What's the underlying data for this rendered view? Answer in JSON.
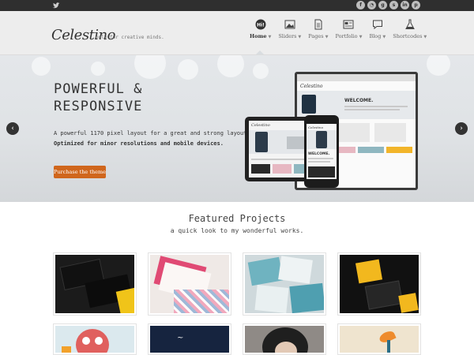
{
  "topbar": {
    "twitter_icon": "twitter-icon",
    "social_icons": [
      "facebook-icon",
      "rss-icon",
      "google-plus-icon",
      "skype-icon",
      "linkedin-icon",
      "pinterest-icon"
    ]
  },
  "header": {
    "logo": "Celestino",
    "tagline": "only for creative minds."
  },
  "nav": [
    {
      "label": "Home",
      "icon": "hi-bubble-icon",
      "active": true
    },
    {
      "label": "Sliders",
      "icon": "slider-image-icon",
      "active": false
    },
    {
      "label": "Pages",
      "icon": "page-icon",
      "active": false
    },
    {
      "label": "Portfolio",
      "icon": "portfolio-icon",
      "active": false
    },
    {
      "label": "Blog",
      "icon": "blog-bubble-icon",
      "active": false
    },
    {
      "label": "Shortcodes",
      "icon": "flask-icon",
      "active": false
    }
  ],
  "hero": {
    "title_line1": "POWERFUL &",
    "title_line2": "RESPONSIVE",
    "text1": "A powerful 1170 pixel layout for a great and strong layout.",
    "text2": "Optimized for minor resolutions and mobile devices.",
    "button": "Purchase the theme",
    "prev": "‹",
    "next": "›",
    "device_welcome": "WELCOME.",
    "device_featured": "Featured Projects",
    "accent": "#d0661c"
  },
  "featured": {
    "title": "Featured Projects",
    "subtitle": "a quick look to my wonderful works."
  },
  "projects": [
    {
      "name": "business-card-dark"
    },
    {
      "name": "pink-pattern-cards"
    },
    {
      "name": "teal-stamp-cards"
    },
    {
      "name": "yellow-black-cards"
    },
    {
      "name": "octopus-illustration"
    },
    {
      "name": "navy-script-cover"
    },
    {
      "name": "dark-hair-portrait"
    },
    {
      "name": "orange-bird-illustration"
    }
  ]
}
